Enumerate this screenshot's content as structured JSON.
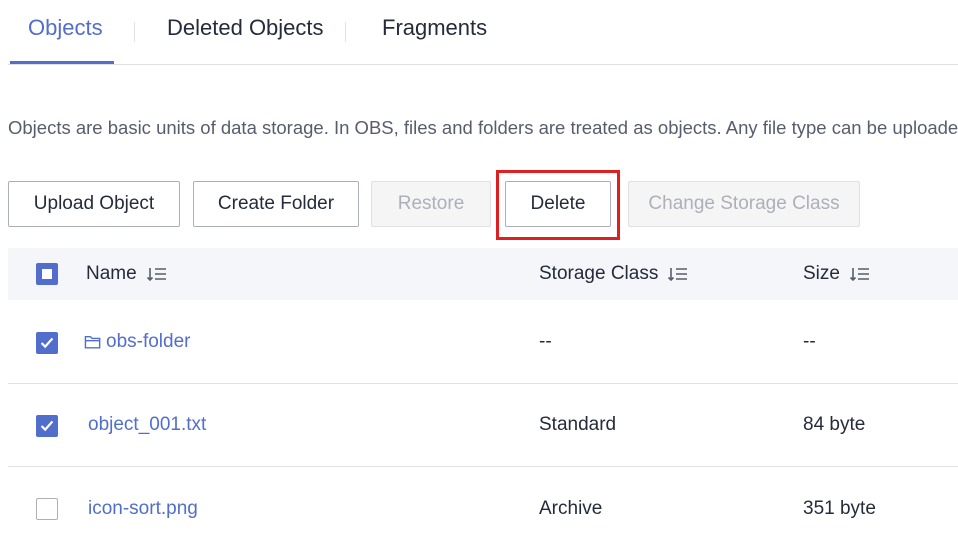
{
  "tabs": [
    {
      "label": "Objects",
      "active": true
    },
    {
      "label": "Deleted Objects",
      "active": false
    },
    {
      "label": "Fragments",
      "active": false
    }
  ],
  "description": "Objects are basic units of data storage. In OBS, files and folders are treated as objects. Any file type can be uploaded anc",
  "toolbar": {
    "upload": "Upload Object",
    "create_folder": "Create Folder",
    "restore": "Restore",
    "delete": "Delete",
    "change_class": "Change Storage Class"
  },
  "table": {
    "columns": [
      "Name",
      "Storage Class",
      "Size"
    ],
    "rows": [
      {
        "name": "obs-folder",
        "is_folder": true,
        "storage_class": "--",
        "size": "--",
        "checked": true
      },
      {
        "name": "object_001.txt",
        "is_folder": false,
        "storage_class": "Standard",
        "size": "84 byte",
        "checked": true
      },
      {
        "name": "icon-sort.png",
        "is_folder": false,
        "storage_class": "Archive",
        "size": "351 byte",
        "checked": false
      }
    ]
  },
  "colors": {
    "accent": "#526ecc",
    "highlight": "#e02020"
  },
  "icons": {
    "sort": "sort-icon",
    "folder": "folder-icon",
    "check": "check-icon"
  }
}
